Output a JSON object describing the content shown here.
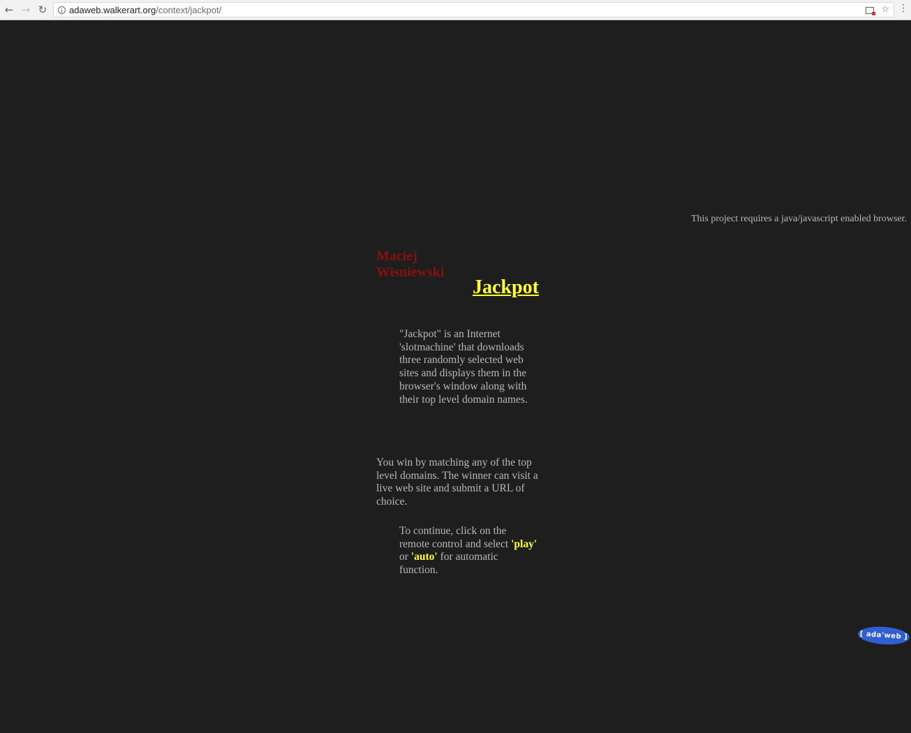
{
  "browser": {
    "back_icon": "back-arrow-icon",
    "forward_icon": "forward-arrow-icon",
    "reload_icon": "reload-icon",
    "url_host": "adaweb.walkerart.org",
    "url_path": "/context/jackpot/",
    "popup_blocked_icon": "popup-blocked-icon",
    "bookmark_icon": "star-icon",
    "menu_icon": "kebab-menu-icon"
  },
  "page": {
    "notice": "This project requires a java/javascript enabled browser.",
    "author_first": "Maciej",
    "author_last": "Wisniewski",
    "title": "Jackpot",
    "description": "\"Jackpot\" is an Internet 'slotmachine' that downloads three randomly selected web sites and displays them in the browser's window along with their top level domain names.",
    "rules": "You win by matching any of the top level domains. The winner can visit a live web site and submit a URL of choice.",
    "continue_prefix": "To continue, click on the remote control and select ",
    "play_label": "'play'",
    "continue_mid": " or ",
    "auto_label": "'auto'",
    "continue_suffix": " for automatic function.",
    "logo_text": "[ ada'web ]"
  },
  "colors": {
    "background": "#1e1e1e",
    "text": "#b8b8b8",
    "highlight": "#ffff33",
    "author": "#8a1010",
    "logo": "#2f5fd0"
  }
}
